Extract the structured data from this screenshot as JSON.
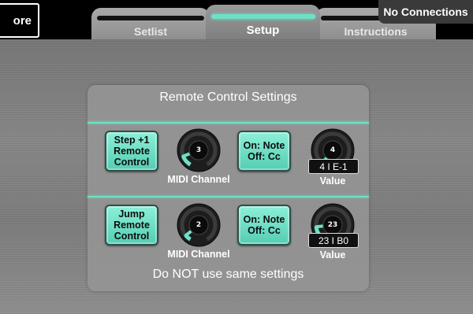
{
  "header": {
    "more_label": "ore",
    "connection_status": "No Connections",
    "tabs": [
      {
        "label": "Setlist",
        "active": false
      },
      {
        "label": "Setup",
        "active": true
      },
      {
        "label": "Instructions",
        "active": false
      }
    ]
  },
  "panel": {
    "title": "Remote Control Settings",
    "footer_note": "Do NOT use same settings",
    "rows": [
      {
        "action_button": "Step +1\nRemote\nControl",
        "channel_knob": {
          "value_label": "3",
          "level": 0.13
        },
        "channel_caption": "MIDI Channel",
        "type_button": "On: Note\nOff: Cc",
        "value_knob": {
          "value_label": "4",
          "level": 0.03
        },
        "value_display": "4 I E-1",
        "value_caption": "Value"
      },
      {
        "action_button": "Jump\nRemote\nControl",
        "channel_knob": {
          "value_label": "2",
          "level": 0.07
        },
        "channel_caption": "MIDI Channel",
        "type_button": "On: Note\nOff: Cc",
        "value_knob": {
          "value_label": "23",
          "level": 0.18
        },
        "value_display": "23 I B0",
        "value_caption": "Value"
      }
    ]
  },
  "colors": {
    "accent": "#6fe0c6",
    "button_fill": "#6fd9bf",
    "background": "#7d7d7d"
  }
}
